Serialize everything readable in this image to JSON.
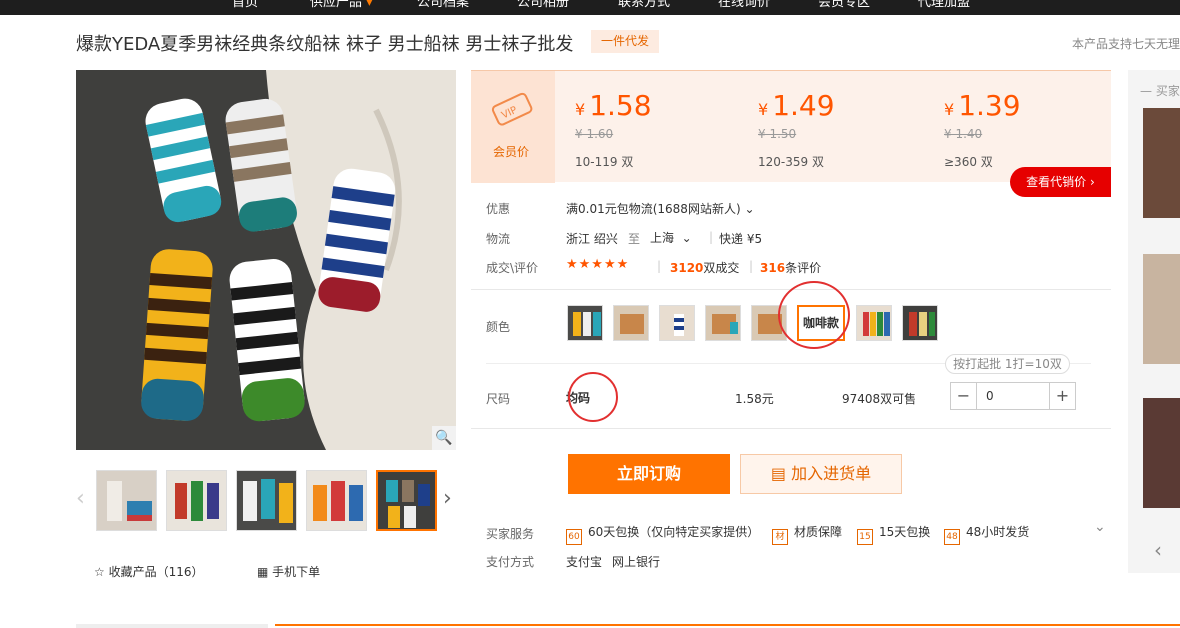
{
  "nav": {
    "items": [
      "首页",
      "供应产品",
      "公司档案",
      "公司相册",
      "联系方式",
      "在线询价",
      "会员专区",
      "代理加盟"
    ],
    "active_index": 1
  },
  "product": {
    "title": "爆款YEDA夏季男袜经典条纹船袜 袜子 男士船袜 男士袜子批发",
    "badge": "一件代发",
    "right_note": "本产品支持七天无理"
  },
  "gallery": {
    "thumb_count": 5,
    "selected_thumb": 4
  },
  "actions": {
    "favorite_label": "收藏产品（116）",
    "mobile_order_label": "手机下单"
  },
  "pricing": {
    "vip_label": "会员价",
    "tiers": [
      {
        "price": "1.58",
        "original": "¥ 1.60",
        "range": "10-119 双"
      },
      {
        "price": "1.49",
        "original": "¥ 1.50",
        "range": "120-359 双"
      },
      {
        "price": "1.39",
        "original": "¥ 1.40",
        "range": "≥360 双"
      }
    ],
    "currency": "¥",
    "agent_price_button": "查看代销价"
  },
  "info": {
    "promo_label": "优惠",
    "promo_value": "满0.01元包物流(1688网站新人)",
    "logistics_label": "物流",
    "from": "浙江 绍兴",
    "to_word": "至",
    "to": "上海",
    "shipping": "快递 ¥5",
    "deals_label": "成交\\评价",
    "stars": "★★★★★",
    "deals_count": "3120",
    "deals_suffix": "双成交",
    "reviews_count": "316",
    "reviews_suffix": "条评价"
  },
  "color": {
    "label": "颜色",
    "selected_text": "咖啡款"
  },
  "size": {
    "label": "尺码",
    "value": "均码",
    "price": "1.58元",
    "stock": "97408双可售",
    "tip": "按打起批 1打=10双",
    "qty_value": "0"
  },
  "buttons": {
    "buy": "立即订购",
    "cart": "加入进货单"
  },
  "services": {
    "label": "买家服务",
    "items": [
      {
        "icon": "60",
        "text": "60天包换（仅向特定买家提供）"
      },
      {
        "icon": "材",
        "text": "材质保障"
      },
      {
        "icon": "15",
        "text": "15天包换"
      },
      {
        "icon": "48",
        "text": "48小时发货"
      }
    ],
    "payment_label": "支付方式",
    "payment_methods": [
      "支付宝",
      "网上银行"
    ]
  },
  "side": {
    "title": "买家"
  },
  "colors": {
    "accent": "#ff7300",
    "price": "#ff5500",
    "red": "#e60000",
    "annotation": "#e23030"
  }
}
